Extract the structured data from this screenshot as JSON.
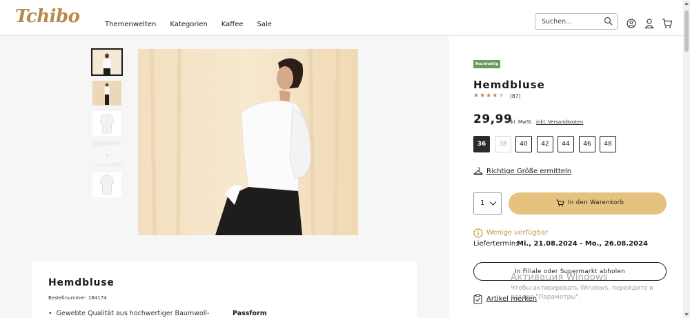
{
  "header": {
    "logo": "Tchibo",
    "nav": [
      "Themenwelten",
      "Kategorien",
      "Kaffee",
      "Sale"
    ],
    "search_placeholder": "Suchen..."
  },
  "gallery": {
    "thumbnails": [
      "model-front",
      "model-full",
      "shirt-front",
      "shirt-detail",
      "shirt-back"
    ],
    "active_index": 0
  },
  "product": {
    "badge": "Nachhaltig",
    "title": "Hemdbluse",
    "rating": 4.5,
    "rating_count": "(87)",
    "price": "29,99",
    "tax_note": "inkl. MwSt.",
    "shipping_link": "inkl. Versandkosten",
    "sizes": [
      {
        "label": "36",
        "state": "selected"
      },
      {
        "label": "38",
        "state": "disabled"
      },
      {
        "label": "40",
        "state": "available"
      },
      {
        "label": "42",
        "state": "available"
      },
      {
        "label": "44",
        "state": "available"
      },
      {
        "label": "46",
        "state": "available"
      },
      {
        "label": "48",
        "state": "available"
      }
    ],
    "size_guide": "Richtige Größe ermitteln",
    "quantity": "1",
    "add_to_cart": "In den Warenkorb",
    "availability": "Wenige verfügbar",
    "delivery_label": "Liefertermin:",
    "delivery_date": "Mi., 21.08.2024 - Mo., 26.08.2024",
    "store_pickup": "In Filiale oder Supermarkt abholen",
    "remember": "Artikel merken"
  },
  "description": {
    "title": "Hemdbluse",
    "article_number": "Bestellnummer: 184174",
    "bullet_1": "Gewebte Qualität aus hochwertiger Baumwoll-",
    "section_passform": "Passform"
  },
  "watermark": {
    "title": "Активация Windows",
    "text": "Чтобы активировать Windows, перейдите в раздел \"Параметры\"."
  },
  "colors": {
    "brand": "#b8894a",
    "cart_button": "#e5c27d",
    "badge": "#6a9a5e",
    "availability": "#c69446"
  }
}
